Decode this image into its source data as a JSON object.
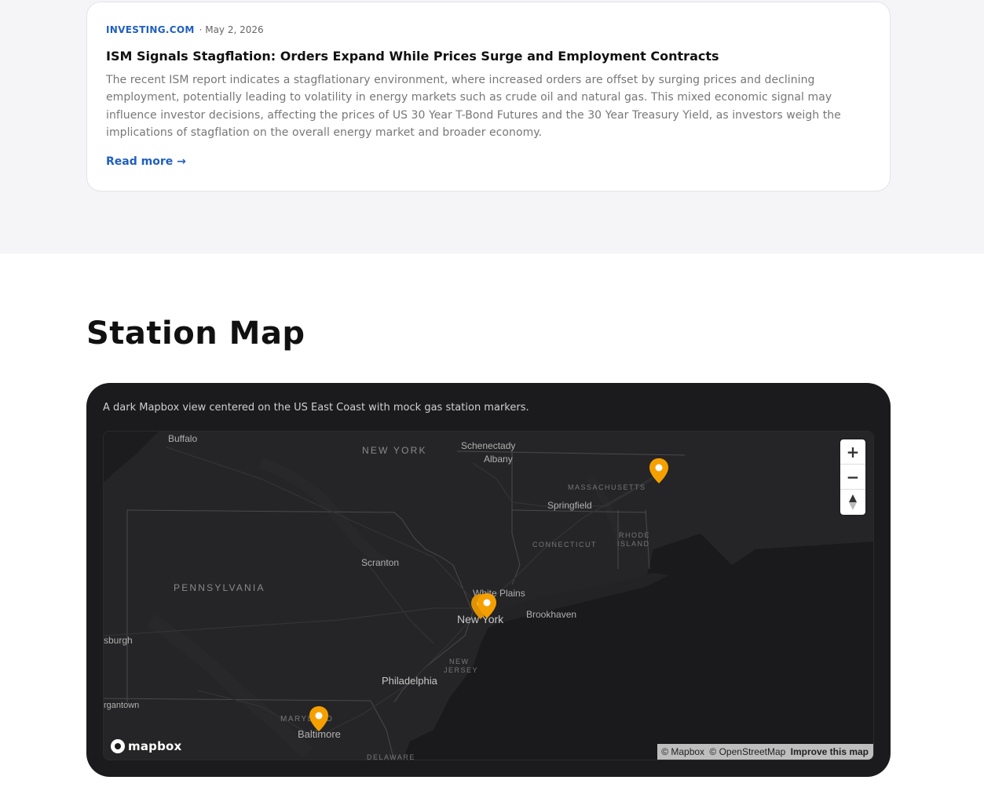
{
  "news": {
    "source": "INVESTING.COM",
    "date": "· May 2, 2026",
    "title": "ISM Signals Stagflation: Orders Expand While Prices Surge and Employment Contracts",
    "summary": "The recent ISM report indicates a stagflationary environment, where increased orders are offset by surging prices and declining employment, potentially leading to volatility in energy markets such as crude oil and natural gas. This mixed economic signal may influence investor decisions, affecting the prices of US 30 Year T-Bond Futures and the 30 Year Treasury Yield, as investors weigh the implications of stagflation on the overall energy market and broader economy.",
    "read_more": "Read more →"
  },
  "station_map": {
    "title": "Station Map",
    "description": "A dark Mapbox view centered on the US East Coast with mock gas station markers.",
    "zoom_in": "+",
    "zoom_out": "−",
    "compass": "▲",
    "logo": "mapbox",
    "attribution": {
      "mapbox": "© Mapbox",
      "osm": "© OpenStreetMap",
      "improve": "Improve this map"
    },
    "labels": {
      "buffalo": "Buffalo",
      "new_york_state": "NEW YORK",
      "schenectady": "Schenectady",
      "albany": "Albany",
      "massachusetts": "MASSACHUSETTS",
      "springfield": "Springfield",
      "connecticut": "CONNECTICUT",
      "rhode": "RHODE",
      "island": "ISLAND",
      "scranton": "Scranton",
      "pennsylvania": "PENNSYLVANIA",
      "white_plains": "White Plains",
      "new_york_city": "New York",
      "brookhaven": "Brookhaven",
      "pittsburgh": "sburgh",
      "new_jersey_1": "NEW",
      "new_jersey_2": "JERSEY",
      "philadelphia": "Philadelphia",
      "morgantown": "rgantown",
      "maryland": "MARYLAND",
      "baltimore": "Baltimore",
      "delaware": "DELAWARE"
    },
    "marker_color": "#f5a000",
    "marker_icon": "map-pin-icon"
  }
}
